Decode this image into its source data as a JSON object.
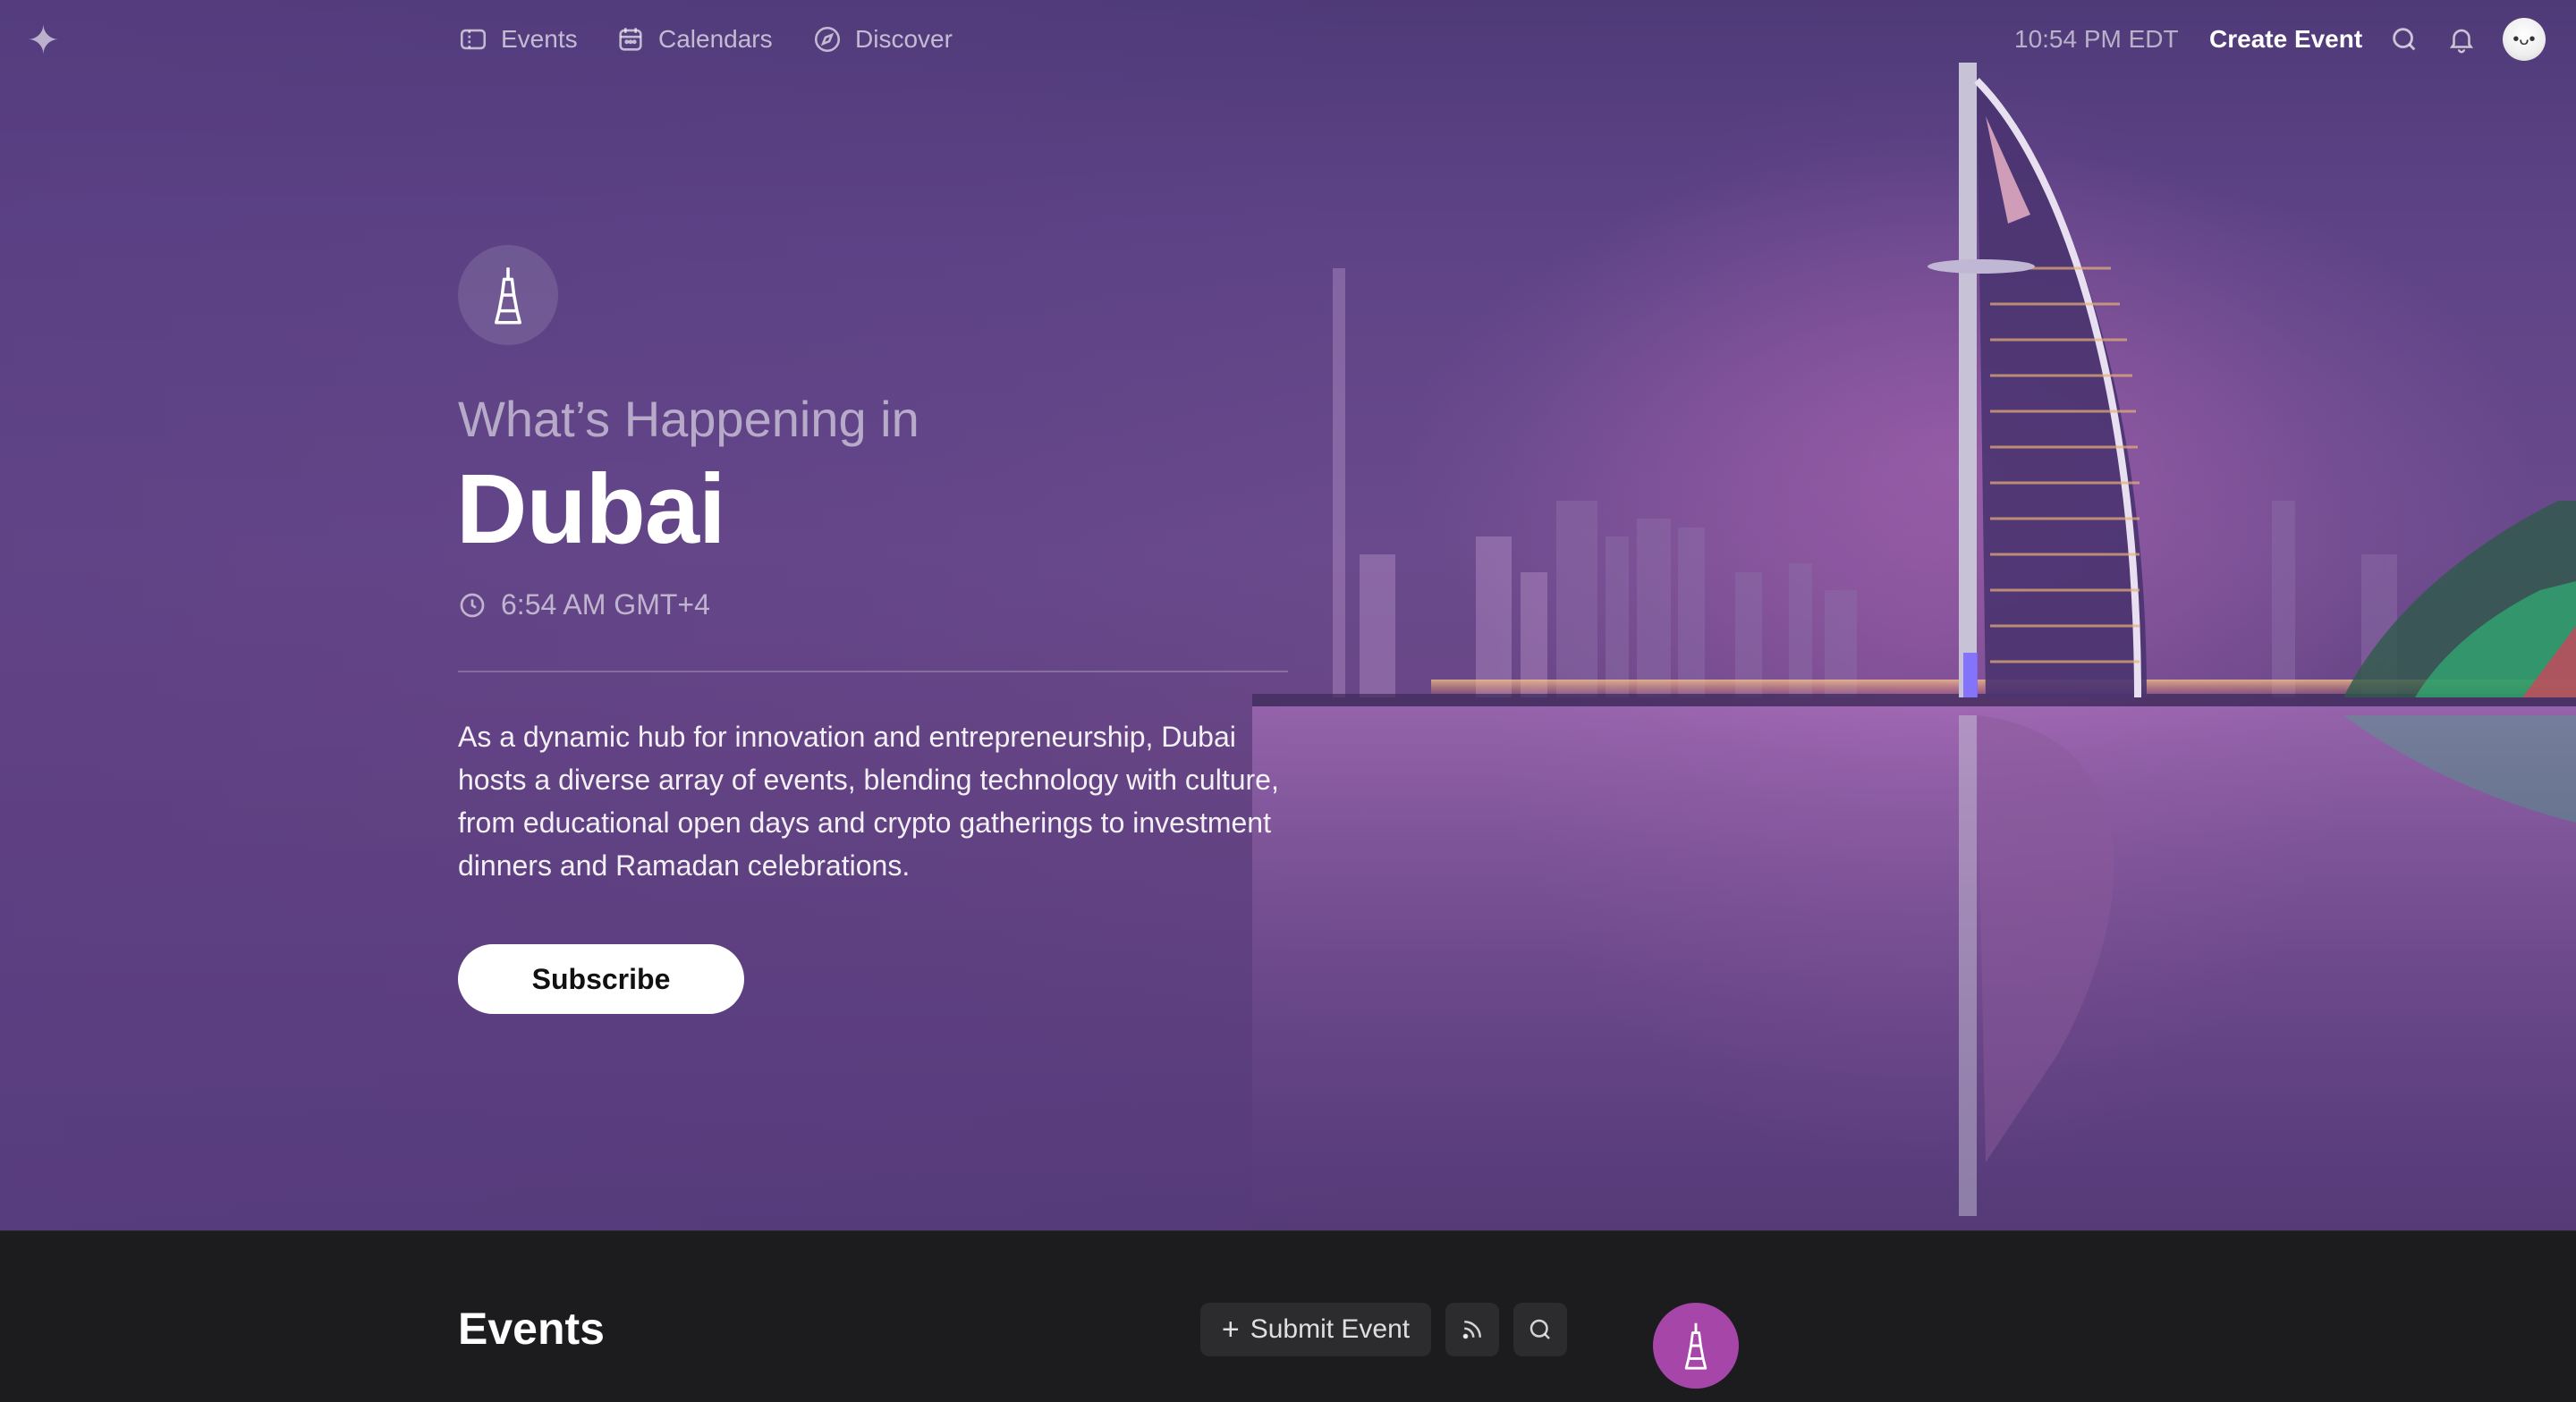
{
  "nav": {
    "logo_icon": "sparkle-icon",
    "links": [
      {
        "label": "Events",
        "icon": "ticket-icon"
      },
      {
        "label": "Calendars",
        "icon": "calendar-icon"
      },
      {
        "label": "Discover",
        "icon": "compass-icon"
      }
    ],
    "current_time": "10:54 PM EDT",
    "create_event_label": "Create Event",
    "search_icon": "search-icon",
    "notifications_icon": "bell-icon",
    "avatar_icon": "avatar"
  },
  "hero": {
    "city_icon": "burj-khalifa-icon",
    "eyebrow": "What’s Happening in",
    "city": "Dubai",
    "local_time": "6:54 AM GMT+4",
    "description": "As a dynamic hub for innovation and entrepreneurship, Dubai hosts a diverse array of events, blending technology with culture, from educational open days and crypto gatherings to investment dinners and Ramadan celebrations.",
    "subscribe_label": "Subscribe"
  },
  "events": {
    "title": "Events",
    "submit_label": "Submit Event",
    "rss_icon": "rss-icon",
    "search_icon": "search-icon",
    "badge_color": "#a646a8"
  },
  "colors": {
    "hero_purple": "#63468a",
    "dark_bg": "#1c1c1e"
  }
}
